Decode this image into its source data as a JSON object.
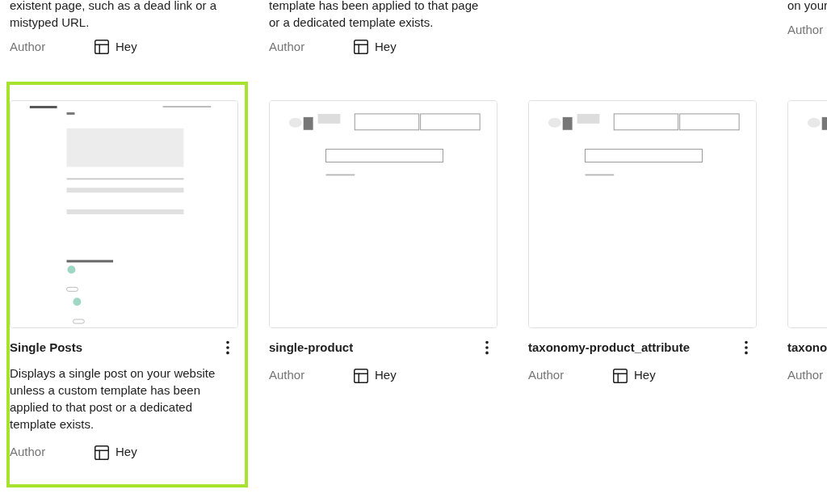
{
  "top_row": [
    {
      "kind": "card",
      "description_lines": [
        "existent page, such as a dead link or a",
        "mistyped URL."
      ],
      "author_label": "Author",
      "author": "Hey"
    },
    {
      "kind": "card",
      "description_lines": [
        "template has been applied to that page",
        "or a dedicated template exists."
      ],
      "author_label": "Author",
      "author": "Hey"
    },
    {
      "kind": "empty"
    },
    {
      "kind": "card",
      "description_lines": [
        "on your"
      ],
      "author_label": "Author"
    }
  ],
  "templates": [
    {
      "name": "Single Posts",
      "selected": true,
      "kind": "post",
      "menu": true,
      "description_lines": [
        "Displays a single post on your website",
        "unless a custom template has been",
        "applied to that post or a dedicated",
        "template exists."
      ],
      "author_label": "Author",
      "author": "Hey"
    },
    {
      "name": "single-product",
      "selected": false,
      "kind": "header",
      "menu": true,
      "author_label": "Author",
      "author": "Hey"
    },
    {
      "name": "taxonomy-product_attribute",
      "selected": false,
      "kind": "header",
      "menu": true,
      "author_label": "Author",
      "author": "Hey"
    },
    {
      "name": "taxono",
      "selected": false,
      "kind": "header",
      "author_label": "Author"
    }
  ]
}
